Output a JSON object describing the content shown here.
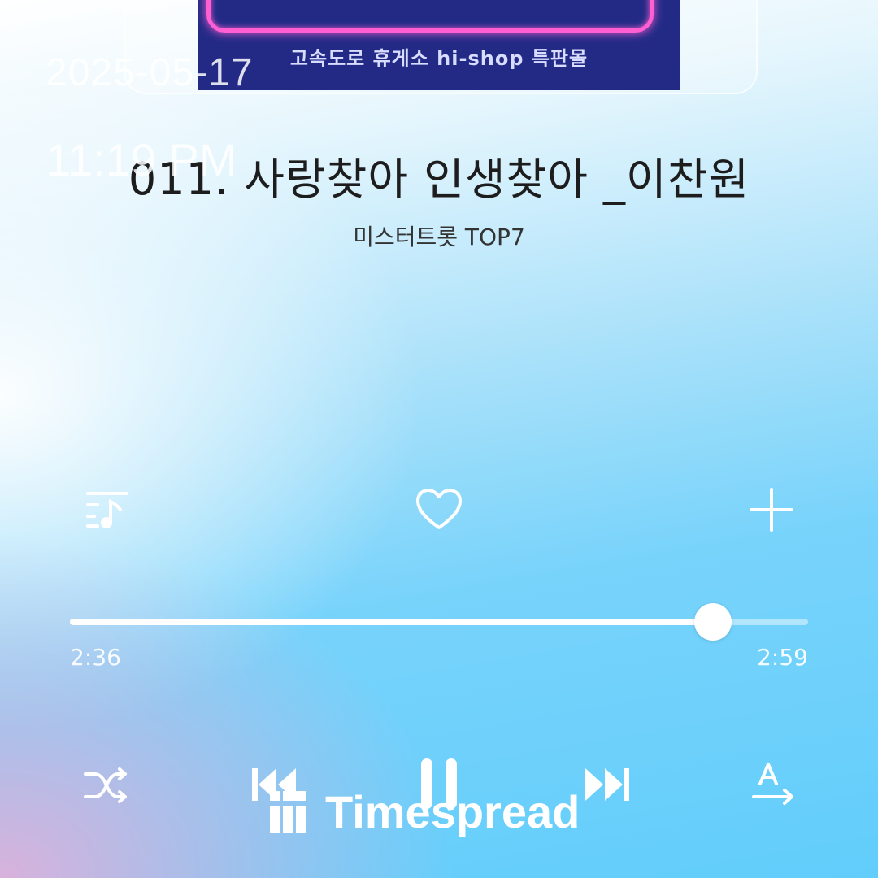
{
  "ad_banner": {
    "text": "고속도로 휴게소 hi-shop 특판몰"
  },
  "overlay": {
    "date": "2025-05-17",
    "time": "11:19 PM"
  },
  "track": {
    "title": "011. 사랑찾아 인생찾아 _이찬원",
    "artist": "미스터트롯 TOP7"
  },
  "actions": {
    "playlist_icon": "playlist-music-icon",
    "like_icon": "heart-outline-icon",
    "add_icon": "plus-icon"
  },
  "progress": {
    "elapsed": "2:36",
    "duration": "2:59",
    "fraction": 0.8715
  },
  "controls": {
    "shuffle_icon": "shuffle-icon",
    "previous_icon": "skip-previous-icon",
    "play_pause_icon": "pause-icon",
    "next_icon": "skip-next-icon",
    "lyrics_icon": "lyrics-translate-icon"
  },
  "watermark": {
    "text": "Timespread"
  },
  "colors": {
    "ad_background": "#232a86",
    "ad_neon": "#ff5fd2",
    "icon": "#ffffff",
    "title": "#1d1d1d"
  }
}
